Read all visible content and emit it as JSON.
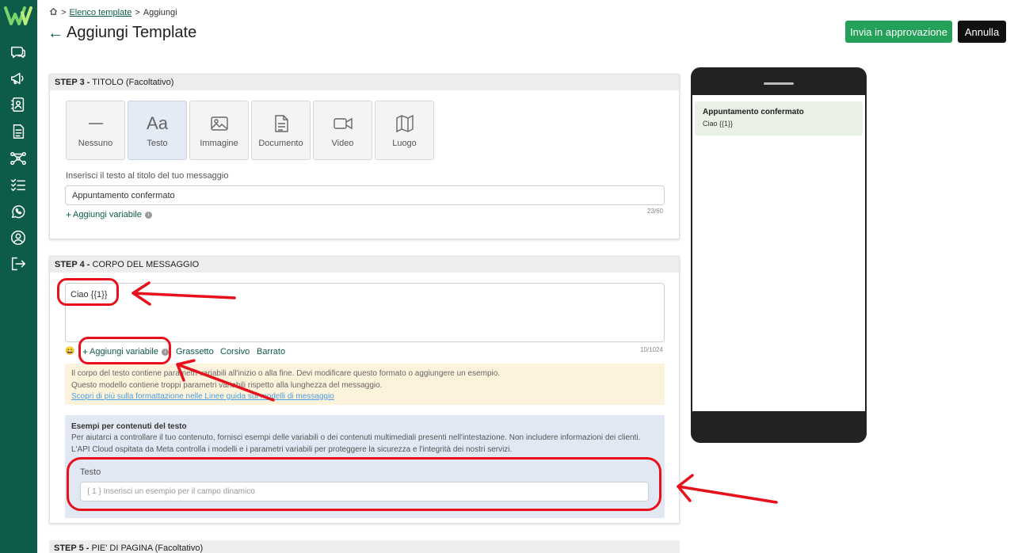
{
  "sidebar": {
    "items": [
      {
        "icon": "chat-icon"
      },
      {
        "icon": "megaphone-icon"
      },
      {
        "icon": "contacts-icon"
      },
      {
        "icon": "document-icon"
      },
      {
        "icon": "flow-icon"
      },
      {
        "icon": "checklist-icon"
      },
      {
        "icon": "whatsapp-icon"
      },
      {
        "icon": "user-icon"
      },
      {
        "icon": "logout-icon"
      }
    ]
  },
  "header": {
    "breadcrumb_link": "Elenco template",
    "breadcrumb_sep": ">",
    "breadcrumb_current": "Aggiungi",
    "title": "Aggiungi Template",
    "approve_label": "Invia in approvazione",
    "cancel_label": "Annulla"
  },
  "step3": {
    "step": "STEP 3 -",
    "title": "TITOLO (Facoltativo)",
    "types": [
      {
        "label": "Nessuno",
        "icon": "dash-icon"
      },
      {
        "label": "Testo",
        "icon": "text-icon",
        "selected": true
      },
      {
        "label": "Immagine",
        "icon": "image-icon"
      },
      {
        "label": "Documento",
        "icon": "document-icon"
      },
      {
        "label": "Video",
        "icon": "video-icon"
      },
      {
        "label": "Luogo",
        "icon": "map-icon"
      }
    ],
    "field_label": "Inserisci il testo al titolo del tuo messaggio",
    "value": "Appuntamento confermato",
    "add_variable": "Aggiungi variabile",
    "counter": "23/60"
  },
  "step4": {
    "step": "STEP 4 -",
    "title": "CORPO DEL MESSAGGIO",
    "body": "Ciao {{1}}",
    "emoji": "😀",
    "add_variable": "Aggiungi variabile",
    "bold": "Grassetto",
    "italic": "Corsivo",
    "strike": "Barrato",
    "counter": "10/1024",
    "warning_line1": "Il corpo del testo contiene parametri variabili all'inizio o alla fine. Devi modificare questo formato o aggiungere un esempio.",
    "warning_line2": "Questo modello contiene troppi parametri variabili rispetto alla lunghezza del messaggio.",
    "warning_link": "Scopri di più sulla formattazione nelle Linee guida sui modelli di messaggio",
    "examples_title": "Esempi per contenuti del testo",
    "examples_desc": "Per aiutarci a controllare il tuo contenuto, fornisci esempi delle variabili o dei contenuti multimediali presenti nell'intestazione. Non includere informazioni dei clienti. L'API Cloud ospitata da Meta controlla i modelli e i parametri variabili per proteggere la sicurezza e l'integrità dei nostri servizi.",
    "example_label": "Testo",
    "example_placeholder": "{ 1 } Inserisci un esempio per il campo dinamico"
  },
  "preview": {
    "title": "Appuntamento confermato",
    "body": "Ciao {{1}}"
  },
  "step5": {
    "step": "STEP 5 -",
    "title": "PIE' DI PAGINA (Facoltativo)"
  },
  "colors": {
    "sidebar": "#0d5c4a",
    "primary_button": "#24a158",
    "annotation": "#e8101a"
  }
}
